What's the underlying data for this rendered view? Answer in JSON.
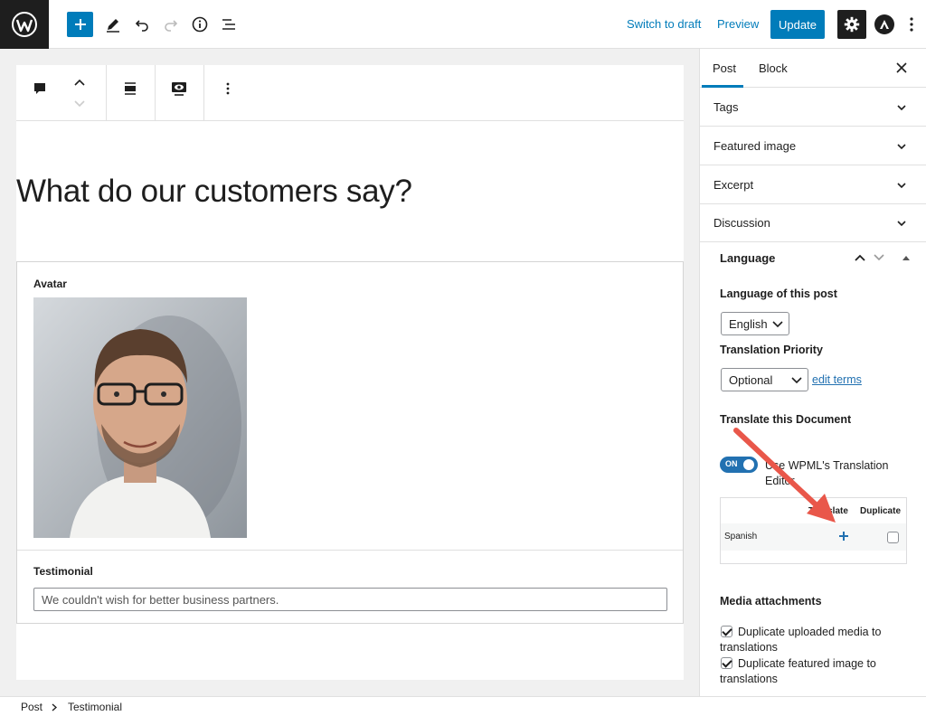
{
  "topbar": {
    "switch_to_draft": "Switch to draft",
    "preview": "Preview",
    "update": "Update",
    "accent": "#007cba"
  },
  "editor": {
    "title": "What do our customers say?",
    "avatar_label": "Avatar",
    "testimonial_label": "Testimonial",
    "testimonial_value": "We couldn't wish for better business partners."
  },
  "sidebar": {
    "tabs": [
      "Post",
      "Block"
    ],
    "panels": [
      "Tags",
      "Featured image",
      "Excerpt",
      "Discussion"
    ],
    "language": {
      "title": "Language",
      "lang_of_post_label": "Language of this post",
      "lang_value": "English",
      "priority_label": "Translation Priority",
      "priority_value": "Optional",
      "edit_terms": "edit terms",
      "translate_doc_label": "Translate this Document",
      "toggle_state": "ON",
      "toggle_text": "Use WPML's Translation Editor",
      "table_headers": [
        "Translate",
        "Duplicate"
      ],
      "table_rows": [
        {
          "language": "Spanish"
        }
      ],
      "media_label": "Media attachments",
      "media_options": [
        "Duplicate uploaded media to translations",
        "Duplicate featured image to translations"
      ]
    }
  },
  "statusbar": {
    "crumbs": [
      "Post",
      "Testimonial"
    ]
  }
}
